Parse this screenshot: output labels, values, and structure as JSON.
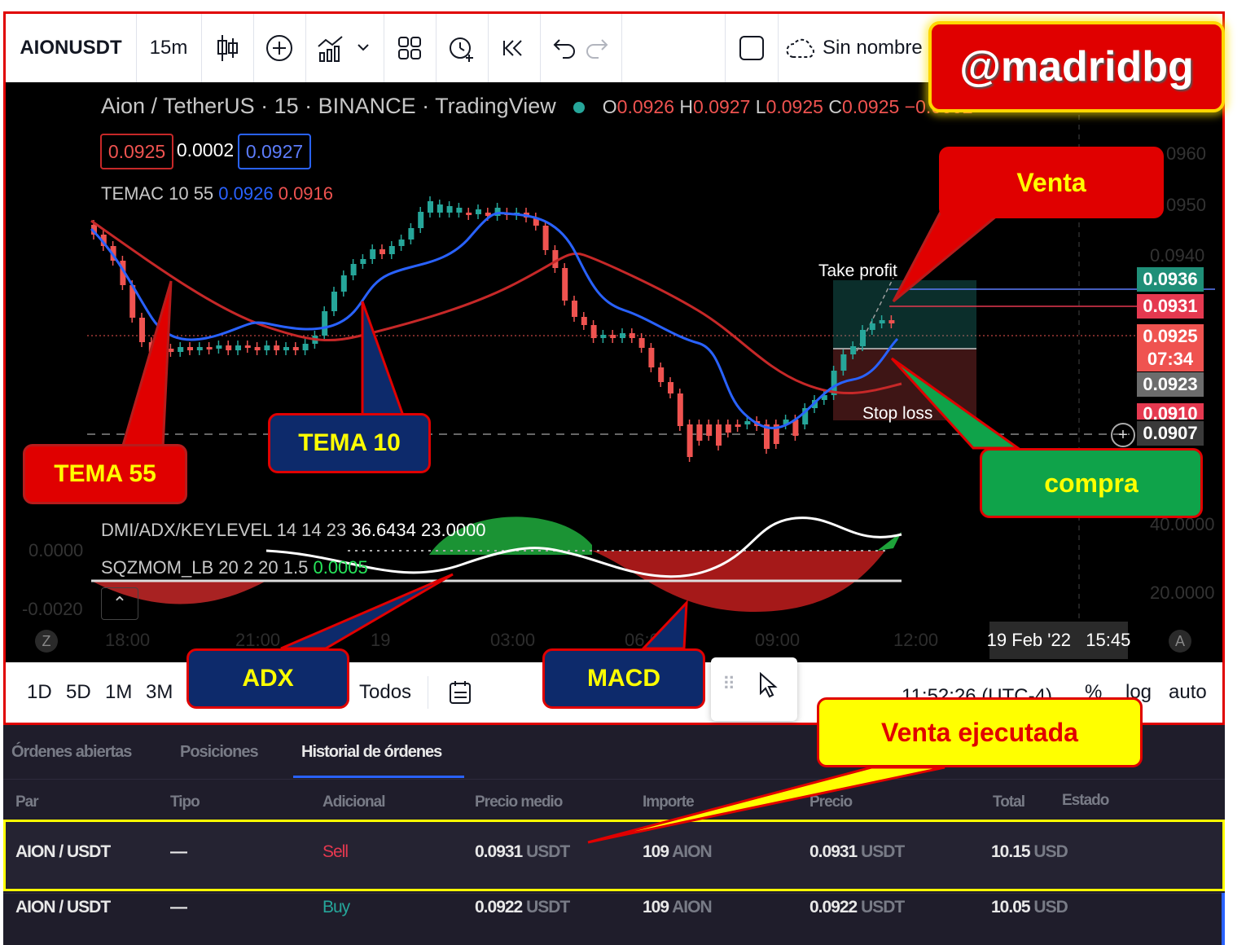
{
  "toolbar": {
    "symbol": "AIONUSDT",
    "interval": "15m",
    "layout_name": "Sin nombre"
  },
  "chart": {
    "title": "Aion / TetherUS · 15 · BINANCE · TradingView",
    "ohlc": {
      "o": "0.0926",
      "h": "0.0927",
      "l": "0.0925",
      "c": "0.0925",
      "chg": "−0.0002"
    },
    "bid": "0.0925",
    "spread": "0.0002",
    "ask": "0.0927",
    "temac": {
      "name": "TEMAC 10 55",
      "v1": "0.0926",
      "v2": "0.0916"
    },
    "dmi": {
      "name": "DMI/ADX/KEYLEVEL 14 14 23",
      "v1": "36.6434",
      "v2": "23.0000"
    },
    "sqz": {
      "name": "SQZMOM_LB 20 2 20 1.5",
      "v1": "0.0005"
    },
    "price_labels": [
      {
        "text": "0.0936",
        "color": "#1f8f78"
      },
      {
        "text": "0.0931",
        "color": "#e53950"
      },
      {
        "text": "0.0925",
        "color": "#ef5350"
      },
      {
        "text": "07:34",
        "color": "#ef5350"
      },
      {
        "text": "0.0923",
        "color": "#6c6c6c"
      },
      {
        "text": "0.0910",
        "color": "#e53950"
      },
      {
        "text": "0.0907",
        "color": "#3a3a3a"
      }
    ],
    "axis_faint": [
      "0960",
      "0950",
      "0.0940",
      "40.0000",
      "20.0000",
      "0.0000",
      "-0.0020"
    ],
    "time_ticks": [
      "18:00",
      "21:00",
      "19",
      "03:00",
      "06:00",
      "09:00",
      "12:00"
    ],
    "crosshair_date": "19 Feb '22   15:45",
    "take_profit": "Take profit",
    "stop_loss": "Stop loss",
    "z_btn": "Z",
    "a_btn": "A",
    "colors": {
      "bull": "#26a69a",
      "bear": "#ef5350",
      "tema10": "#2962ff",
      "tema55": "#c62828"
    }
  },
  "bottombar": {
    "ranges": [
      "1D",
      "5D",
      "1M",
      "3M"
    ],
    "todos": "Todos",
    "clock": "11:52:26 (UTC-4)",
    "pct": "%",
    "log": "log",
    "auto": "auto"
  },
  "orders": {
    "tabs": [
      "Órdenes abiertas",
      "Posiciones",
      "Historial de órdenes"
    ],
    "columns": [
      "Par",
      "Tipo",
      "Adicional",
      "Precio medio",
      "Importe",
      "Precio",
      "Total",
      "Estado"
    ],
    "rows": [
      {
        "pair": "AION / USDT",
        "type": "—",
        "side": "Sell",
        "avg": "0.0931",
        "avg_u": "USDT",
        "qty": "109",
        "qty_u": "AION",
        "price": "0.0931",
        "price_u": "USDT",
        "total": "10.15",
        "total_u": "USD"
      },
      {
        "pair": "AION / USDT",
        "type": "—",
        "side": "Buy",
        "avg": "0.0922",
        "avg_u": "USDT",
        "qty": "109",
        "qty_u": "AION",
        "price": "0.0922",
        "price_u": "USDT",
        "total": "10.05",
        "total_u": "USD"
      }
    ]
  },
  "annotations": {
    "handle": "@madridbg",
    "venta": "Venta",
    "compra": "compra",
    "tema55": "TEMA 55",
    "tema10": "TEMA 10",
    "adx": "ADX",
    "macd": "MACD",
    "venta_ejecutada": "Venta ejecutada"
  }
}
